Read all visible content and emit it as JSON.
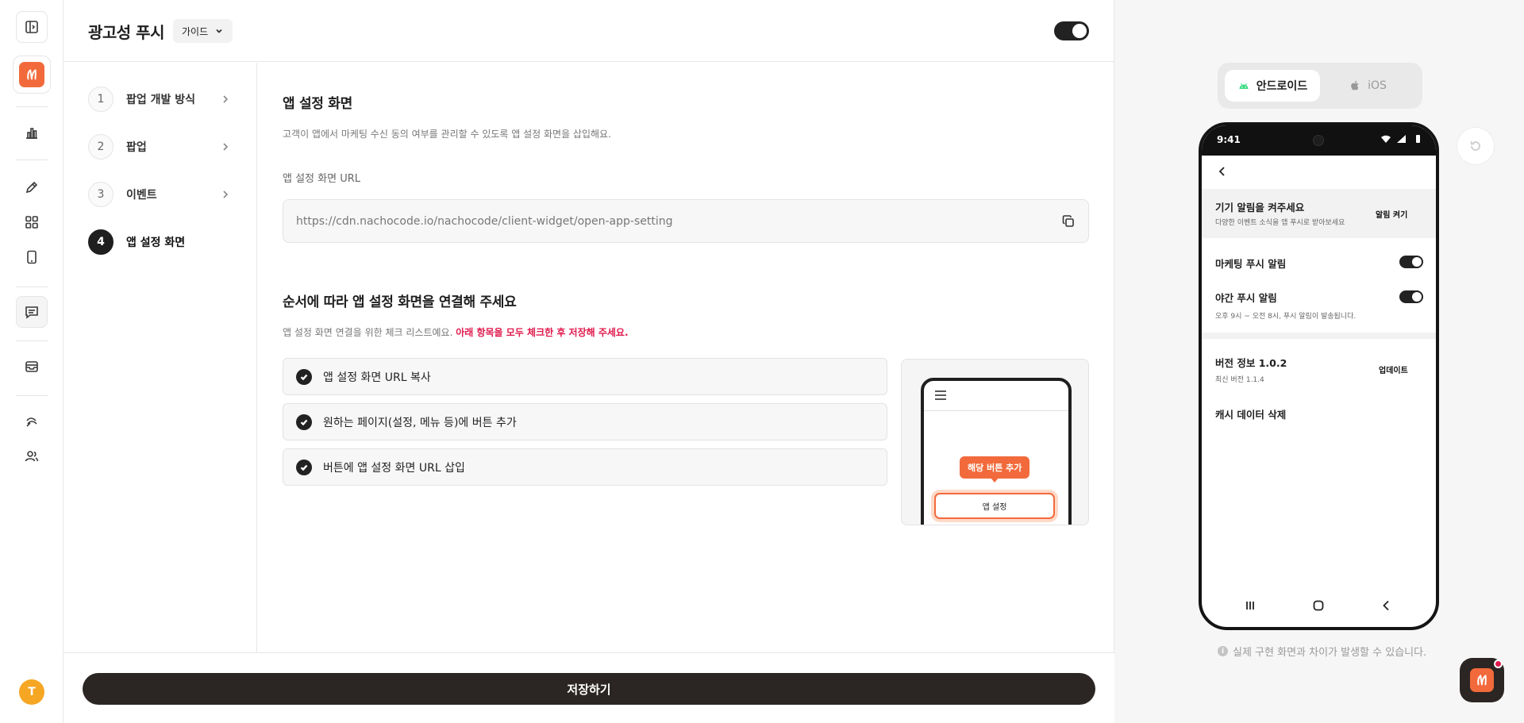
{
  "header": {
    "title": "광고성 푸시",
    "guide_label": "가이드",
    "enabled": true
  },
  "steps": [
    {
      "num": "1",
      "label": "팝업 개발 방식"
    },
    {
      "num": "2",
      "label": "팝업"
    },
    {
      "num": "3",
      "label": "이벤트"
    },
    {
      "num": "4",
      "label": "앱 설정 화면"
    }
  ],
  "content": {
    "title": "앱 설정 화면",
    "description": "고객이 앱에서 마케팅 수신 동의 여부를 관리할 수 있도록 앱 설정 화면을 삽입해요.",
    "url_label": "앱 설정 화면 URL",
    "url_value": "https://cdn.nachocode.io/nachocode/client-widget/open-app-setting",
    "checklist_title": "순서에 따라 앱 설정 화면을 연결해 주세요",
    "checklist_desc": "앱 설정 화면 연결을 위한 체크 리스트예요.",
    "checklist_warn": "아래 항목을 모두 체크한 후 저장해 주세요.",
    "checklist": [
      "앱 설정 화면 URL 복사",
      "원하는 페이지(설정, 메뉴 등)에 버튼 추가",
      "버튼에 앱 설정 화면 URL 삽입"
    ],
    "illus_tooltip": "해당 버튼 추가",
    "illus_button": "앱 설정"
  },
  "footer": {
    "save_label": "저장하기"
  },
  "preview": {
    "tabs": [
      "안드로이드",
      "iOS"
    ],
    "active_tab": "안드로이드",
    "phone": {
      "time": "9:41",
      "promo_title": "기기 알림을 켜주세요",
      "promo_sub": "다양한 이벤트 소식을 앱 푸시로 받아보세요",
      "promo_action": "알림 켜기",
      "marketing_push": "마케팅 푸시 알림",
      "night_push": "야간 푸시 알림",
      "night_sub": "오후 9시 ~ 오전 8시, 푸시 알림이 발송됩니다.",
      "version_title": "버전 정보 1.0.2",
      "version_sub": "최신 버전 1.1.4",
      "update_label": "업데이트",
      "cache_label": "캐시 데이터 삭제"
    },
    "note": "실제 구현 화면과 차이가 발생할 수 있습니다."
  },
  "user": {
    "initial": "T"
  },
  "colors": {
    "accent": "#f26a3c",
    "dark": "#2b2623",
    "warn": "#e0194c"
  }
}
